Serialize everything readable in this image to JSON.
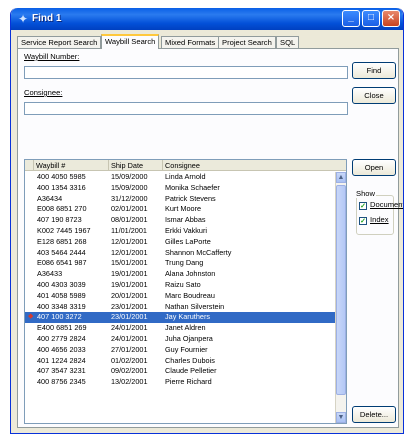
{
  "window": {
    "title": "Find 1",
    "controls": {
      "minimize": "_",
      "maximize": "□",
      "close": "×"
    }
  },
  "tabs": [
    {
      "label": "Service Report Search",
      "active": false
    },
    {
      "label": "Waybill Search",
      "active": true
    },
    {
      "label": "Mixed Formats",
      "active": false
    },
    {
      "label": "Project Search",
      "active": false
    },
    {
      "label": "SQL",
      "active": false
    }
  ],
  "form": {
    "waybill_label": "Waybill Number:",
    "waybill_value": "",
    "consignee_label": "Consignee:",
    "consignee_value": ""
  },
  "buttons": {
    "find": "Find",
    "close": "Close",
    "open": "Open",
    "delete": "Delete..."
  },
  "results": {
    "columns": [
      "Waybill #",
      "Ship Date",
      "Consignee"
    ],
    "rows": [
      [
        "400 4050 5985",
        "15/09/2000",
        "Linda Arnold"
      ],
      [
        "400 1354 3316",
        "15/09/2000",
        "Monika Schaefer"
      ],
      [
        "A36434",
        "31/12/2000",
        "Patrick Stevens"
      ],
      [
        "E008 6851 270",
        "02/01/2001",
        "Kurt Moore"
      ],
      [
        "407 190 8723",
        "08/01/2001",
        "Ismar Abbas"
      ],
      [
        "K002 7445 1967",
        "11/01/2001",
        "Erkki Vakkuri"
      ],
      [
        "E128 6851 268",
        "12/01/2001",
        "Gilles LaPorte"
      ],
      [
        "403 5464 2444",
        "12/01/2001",
        "Shannon McCafferty"
      ],
      [
        "E086 6541 987",
        "15/01/2001",
        "Trung Dang"
      ],
      [
        "A36433",
        "19/01/2001",
        "Alana Johnston"
      ],
      [
        "400 4303 3039",
        "19/01/2001",
        "Raizu Sato"
      ],
      [
        "401 4058 5989",
        "20/01/2001",
        "Marc Boudreau"
      ],
      [
        "400 3348 3319",
        "23/01/2001",
        "Nathan Silverstein"
      ],
      [
        "407 100 3272",
        "23/01/2001",
        "Jay Karuthers"
      ],
      [
        "E400 6851 269",
        "24/01/2001",
        "Janet Aldren"
      ],
      [
        "400 2779 2824",
        "24/01/2001",
        "Juha Ojanpera"
      ],
      [
        "400 4656 2033",
        "27/01/2001",
        "Guy Fournier"
      ],
      [
        "401 1224 2824",
        "01/02/2001",
        "Charles Dubois"
      ],
      [
        "407 3547 3231",
        "09/02/2001",
        "Claude Pelletier"
      ],
      [
        "400 8756 2345",
        "13/02/2001",
        "Pierre Richard"
      ]
    ],
    "selected_index": 13
  },
  "show": {
    "label": "Show",
    "document_label": "Document",
    "document_checked": true,
    "index_label": "Index",
    "index_checked": true
  }
}
